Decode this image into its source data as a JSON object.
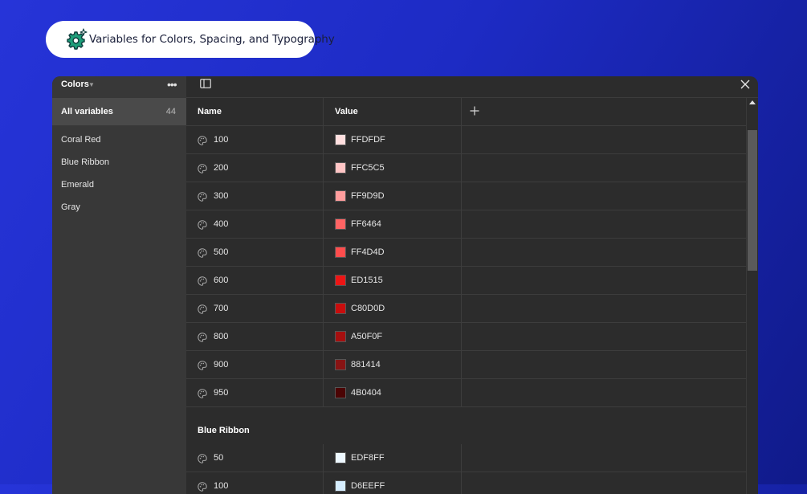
{
  "badge": {
    "text": "Variables for Colors, Spacing, and Typography",
    "icon": "gear-sparkle-icon",
    "icon_color": "#1e9e7a"
  },
  "sidebar": {
    "title": "Colors",
    "all_label": "All variables",
    "all_count": "44",
    "items": [
      "Coral Red",
      "Blue Ribbon",
      "Emerald",
      "Gray"
    ]
  },
  "table": {
    "col_name": "Name",
    "col_value": "Value",
    "rows": [
      {
        "name": "100",
        "hex": "FFDFDF",
        "color": "#FFDFDF"
      },
      {
        "name": "200",
        "hex": "FFC5C5",
        "color": "#FFC5C5"
      },
      {
        "name": "300",
        "hex": "FF9D9D",
        "color": "#FF9D9D"
      },
      {
        "name": "400",
        "hex": "FF6464",
        "color": "#FF6464"
      },
      {
        "name": "500",
        "hex": "FF4D4D",
        "color": "#FF4D4D"
      },
      {
        "name": "600",
        "hex": "ED1515",
        "color": "#ED1515"
      },
      {
        "name": "700",
        "hex": "C80D0D",
        "color": "#C80D0D"
      },
      {
        "name": "800",
        "hex": "A50F0F",
        "color": "#A50F0F"
      },
      {
        "name": "900",
        "hex": "881414",
        "color": "#881414"
      },
      {
        "name": "950",
        "hex": "4B0404",
        "color": "#4B0404"
      }
    ],
    "group2_title": "Blue Ribbon",
    "group2_rows": [
      {
        "name": "50",
        "hex": "EDF8FF",
        "color": "#EDF8FF"
      },
      {
        "name": "100",
        "hex": "D6EEFF",
        "color": "#D6EEFF"
      }
    ]
  }
}
